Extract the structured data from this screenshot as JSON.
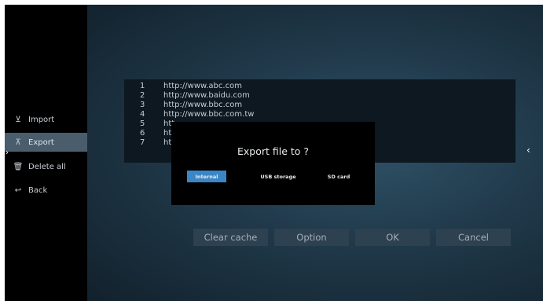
{
  "sidebar": {
    "items": [
      {
        "label": "Import",
        "icon": "import-icon",
        "active": false
      },
      {
        "label": "Export",
        "icon": "export-icon",
        "active": true
      },
      {
        "label": "Delete all",
        "icon": "trash-icon",
        "active": false
      },
      {
        "label": "Back",
        "icon": "back-icon",
        "active": false
      }
    ]
  },
  "url_list": [
    {
      "num": "1",
      "url": "http://www.abc.com"
    },
    {
      "num": "2",
      "url": "http://www.baidu.com"
    },
    {
      "num": "3",
      "url": "http://www.bbc.com"
    },
    {
      "num": "4",
      "url": "http://www.bbc.com.tw"
    },
    {
      "num": "5",
      "url": "htt"
    },
    {
      "num": "6",
      "url": "htt"
    },
    {
      "num": "7",
      "url": "htt"
    }
  ],
  "dialog": {
    "title": "Export file to ?",
    "options": [
      "Internal",
      "USB storage",
      "SD card"
    ],
    "selected": "Internal"
  },
  "buttons": {
    "clear_cache": "Clear cache",
    "option": "Option",
    "ok": "OK",
    "cancel": "Cancel"
  },
  "colors": {
    "accent": "#3b86c7",
    "sidebar_active": "#4a5d6c",
    "background": "#20394a"
  }
}
